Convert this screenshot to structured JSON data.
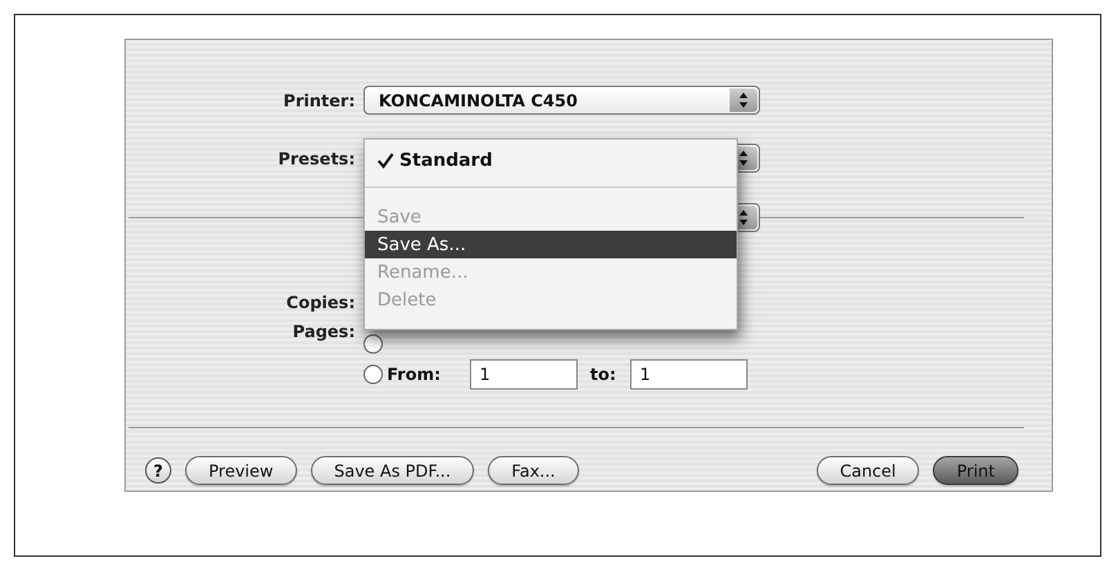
{
  "printer": {
    "label": "Printer:",
    "value": "KONCAMINOLTA C450"
  },
  "presets": {
    "label": "Presets:"
  },
  "presets_menu": {
    "items": [
      {
        "kind": "item",
        "label": "Standard",
        "checked": true,
        "disabled": false,
        "selected": false
      },
      {
        "kind": "separator"
      },
      {
        "kind": "item",
        "label": "Save",
        "checked": false,
        "disabled": true,
        "selected": false
      },
      {
        "kind": "item",
        "label": "Save As...",
        "checked": false,
        "disabled": false,
        "selected": true
      },
      {
        "kind": "item",
        "label": "Rename...",
        "checked": false,
        "disabled": true,
        "selected": false
      },
      {
        "kind": "item",
        "label": "Delete",
        "checked": false,
        "disabled": true,
        "selected": false
      }
    ]
  },
  "copies": {
    "label": "Copies:"
  },
  "pages": {
    "label": "Pages:",
    "all_radio": {
      "selected": false
    },
    "from_radio": {
      "label": "From:",
      "selected": false
    },
    "from_value": "1",
    "to_label": "to:",
    "to_value": "1"
  },
  "help_button": {
    "label": "?"
  },
  "left_buttons": [
    {
      "label": "Preview",
      "default": false
    },
    {
      "label": "Save As PDF...",
      "default": false
    },
    {
      "label": "Fax...",
      "default": false
    }
  ],
  "right_buttons": [
    {
      "label": "Cancel",
      "default": false
    },
    {
      "label": "Print",
      "default": true
    }
  ]
}
